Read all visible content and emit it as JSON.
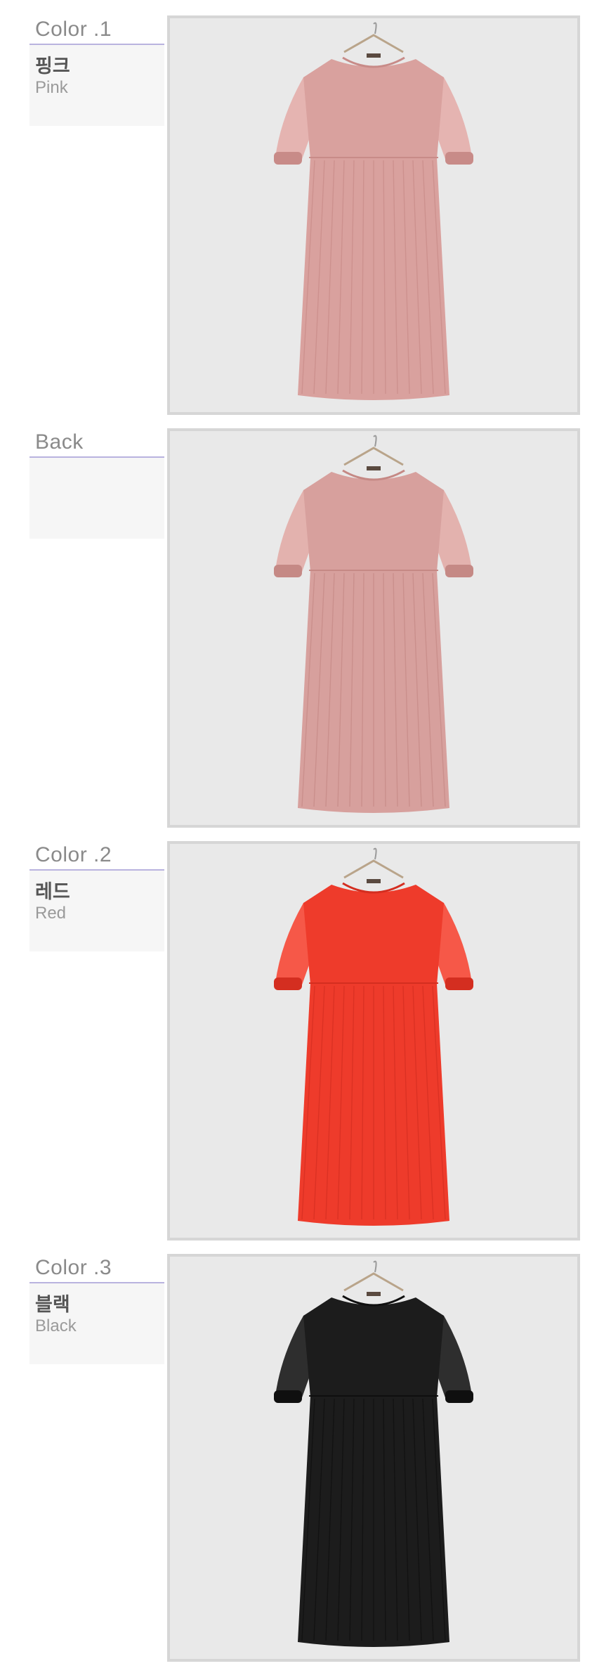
{
  "sections": [
    {
      "title": "Color .1",
      "name_ko": "핑크",
      "name_en": "Pink",
      "dress_color": "#d9a19e",
      "dress_shade": "#c88b88",
      "dress_light": "#e5b4b1"
    },
    {
      "title": "Back",
      "name_ko": "",
      "name_en": "",
      "dress_color": "#d7a09d",
      "dress_shade": "#c58985",
      "dress_light": "#e3b2ae"
    },
    {
      "title": "Color .2",
      "name_ko": "레드",
      "name_en": "Red",
      "dress_color": "#ee3b2b",
      "dress_shade": "#d42e20",
      "dress_light": "#f65848"
    },
    {
      "title": "Color .3",
      "name_ko": "블랙",
      "name_en": "Black",
      "dress_color": "#1c1c1c",
      "dress_shade": "#0f0f0f",
      "dress_light": "#2e2e2e"
    }
  ],
  "colors": {
    "accent_line": "#b9b3df",
    "label_bg": "#f6f6f6",
    "frame_border": "#d6d6d6",
    "photo_bg": "#e9e9e9"
  }
}
